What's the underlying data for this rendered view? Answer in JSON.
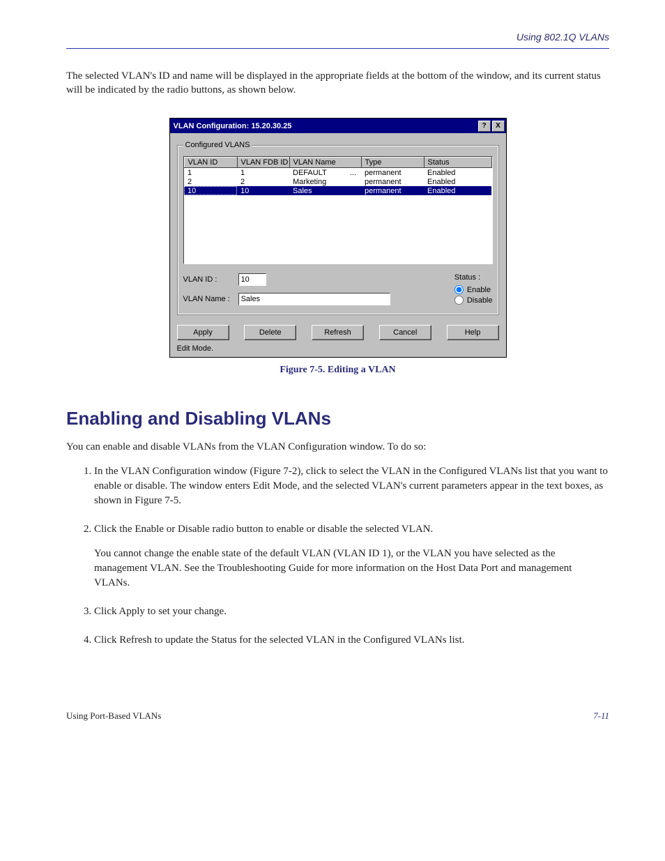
{
  "header": {
    "section_title": "Using 802.1Q VLANs"
  },
  "intro_text": "The selected VLAN's ID and name will be displayed in the appropriate fields at the bottom of the window, and its current status will be indicated by the radio buttons, as shown below.",
  "dialog": {
    "title": "VLAN Configuration: 15.20.30.25",
    "help_icon": "?",
    "close_icon": "X",
    "groupbox_label": "Configured VLANS",
    "columns": [
      "VLAN ID",
      "VLAN FDB ID",
      "VLAN Name",
      "Type",
      "Status"
    ],
    "rows": [
      {
        "id": "1",
        "fdb": "1",
        "name": "DEFAULT",
        "dots": "...",
        "type": "permanent",
        "status": "Enabled",
        "selected": false
      },
      {
        "id": "2",
        "fdb": "2",
        "name": "Marketing",
        "dots": "",
        "type": "permanent",
        "status": "Enabled",
        "selected": false
      },
      {
        "id": "10",
        "fdb": "10",
        "name": "Sales",
        "dots": "",
        "type": "permanent",
        "status": "Enabled",
        "selected": true
      }
    ],
    "vlan_id_label": "VLAN ID :",
    "vlan_id_value": "10",
    "vlan_name_label": "VLAN Name :",
    "vlan_name_value": "Sales",
    "status_label": "Status :",
    "radio_enable": "Enable",
    "radio_disable": "Disable",
    "buttons": {
      "apply": "Apply",
      "delete": "Delete",
      "refresh": "Refresh",
      "cancel": "Cancel",
      "help": "Help"
    },
    "statusbar": "Edit Mode."
  },
  "figure": {
    "label": "Figure 7-5.",
    "caption": "Editing a VLAN"
  },
  "section_heading": "Enabling and Disabling VLANs",
  "section_intro": "You can enable and disable VLANs from the VLAN Configuration window. To do so:",
  "steps": [
    "In the VLAN Configuration window (Figure 7-2), click to select the VLAN in the Configured VLANs list that you want to enable or disable. The window enters Edit Mode, and the selected VLAN's current parameters appear in the text boxes, as shown in Figure 7-5.",
    "Click the Enable or Disable radio button to enable or disable the selected VLAN.",
    "Click Apply to set your change.",
    "Click Refresh to update the Status for the selected VLAN in the Configured VLANs list."
  ],
  "step2_sub": "You cannot change the enable state of the default VLAN (VLAN ID 1), or the VLAN you have selected as the management VLAN. See the Troubleshooting Guide for more information on the Host Data Port and management VLANs.",
  "footer": {
    "left": "Using Port-Based VLANs",
    "right": "7-11"
  }
}
